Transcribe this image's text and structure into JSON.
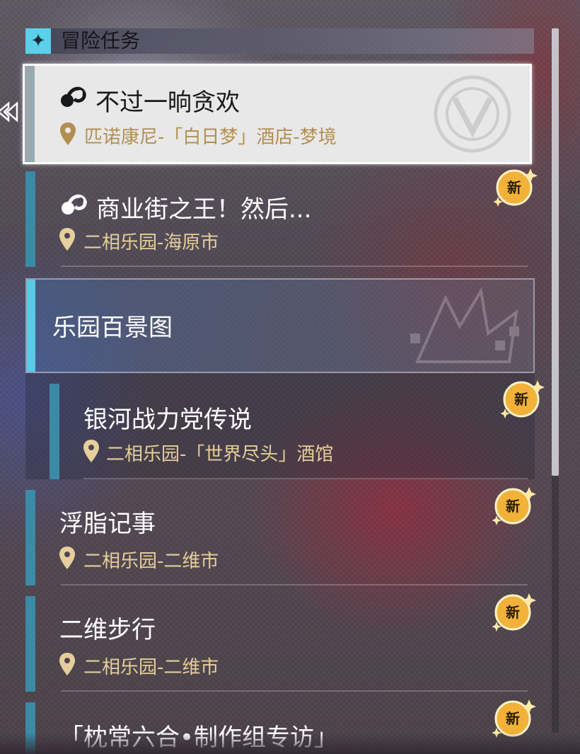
{
  "section": {
    "title": "冒险任务",
    "icon": "sparkle-icon"
  },
  "quests": [
    {
      "title": "不过一晌贪欢",
      "location": "匹诺康尼-「白日梦」酒店-梦境",
      "icon": "mission-icon",
      "selected": true
    },
    {
      "title": "商业街之王！然后...",
      "location": "二相乐园-海原市",
      "icon": "mission-icon",
      "badge": "新"
    }
  ],
  "category": {
    "title": "乐园百景图"
  },
  "sub_quests": [
    {
      "title": "银河战力党传说",
      "location": "二相乐园-「世界尽头」酒馆",
      "badge": "新"
    }
  ],
  "more_quests": [
    {
      "title": "浮脂记事",
      "location": "二相乐园-二维市",
      "badge": "新"
    },
    {
      "title": "二维步行",
      "location": "二相乐园-二维市",
      "badge": "新"
    },
    {
      "title": "「枕常六合•制作组专访」",
      "badge": "新"
    }
  ],
  "colors": {
    "accent": "#5bd0ea",
    "location": "#e6cf9a",
    "badge": "#f2b23a"
  }
}
